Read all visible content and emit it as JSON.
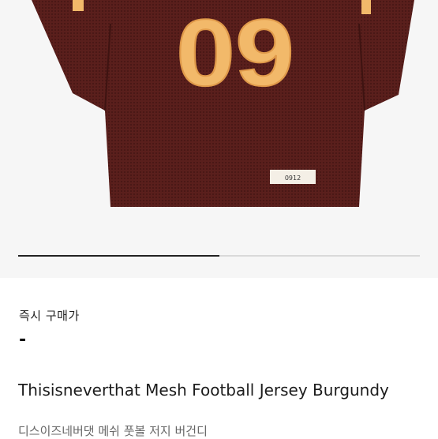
{
  "product": {
    "jersey_number": "09",
    "tag_text": "0912",
    "carousel_progress": 0.5,
    "price_label": "즉시 구매가",
    "price_value": "-",
    "title": "Thisisneverthat Mesh Football Jersey Burgundy",
    "subtitle": "디스이즈네버댓 메쉬 풋볼 저지 버건디"
  },
  "colors": {
    "jersey": "#5a1f1c",
    "number": "#f2b96a",
    "background": "#f6f6f6"
  }
}
